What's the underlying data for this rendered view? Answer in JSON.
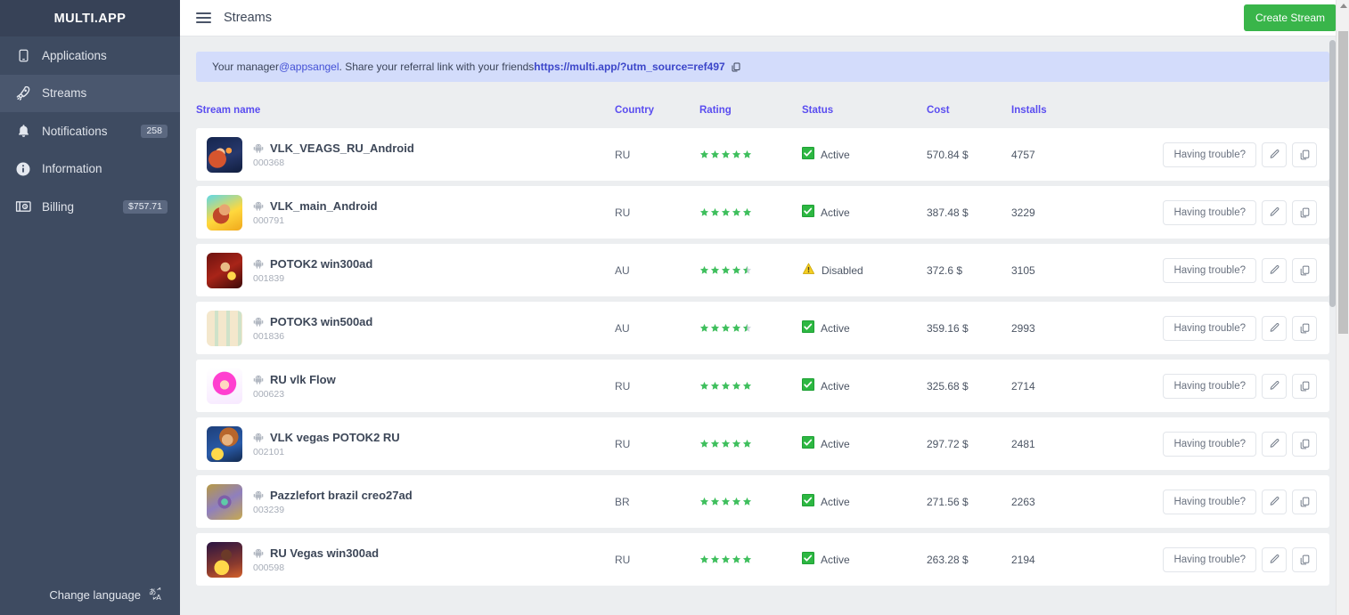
{
  "sidebar": {
    "brand": "MULTI.APP",
    "items": [
      {
        "label": "Applications",
        "icon": "phone-icon",
        "badge": "",
        "active": false
      },
      {
        "label": "Streams",
        "icon": "rocket-icon",
        "badge": "",
        "active": true
      },
      {
        "label": "Notifications",
        "icon": "bell-icon",
        "badge": "258",
        "active": false
      },
      {
        "label": "Information",
        "icon": "info-icon",
        "badge": "",
        "active": false
      },
      {
        "label": "Billing",
        "icon": "money-icon",
        "badge": "$757.71",
        "active": false
      }
    ],
    "footer": {
      "label": "Change language",
      "icon": "translate-icon"
    }
  },
  "header": {
    "menu_icon": "hamburger-icon",
    "title": "Streams",
    "create_button": "Create Stream"
  },
  "notice": {
    "prefix": "Your manager ",
    "handle": "@appsangel",
    "middle": ". Share your referral link with your friends ",
    "link": "https://multi.app/?utm_source=ref497",
    "copy_icon": "copy-icon"
  },
  "table": {
    "columns": [
      "Stream name",
      "Country",
      "Rating",
      "Status",
      "Cost",
      "Installs"
    ],
    "actions": {
      "trouble_label": "Having trouble?",
      "edit_icon": "pencil-icon",
      "copy_icon": "copy-icon"
    },
    "rows": [
      {
        "name": "VLK_VEAGS_RU_Android",
        "id": "000368",
        "country": "RU",
        "rating": 5,
        "status": "Active",
        "status_icon": "check-box-icon",
        "cost": "570.84 $",
        "installs": "4757",
        "thumb": "thumb-vlk-veags"
      },
      {
        "name": "VLK_main_Android",
        "id": "000791",
        "country": "RU",
        "rating": 5,
        "status": "Active",
        "status_icon": "check-box-icon",
        "cost": "387.48 $",
        "installs": "3229",
        "thumb": "thumb-vlk-main"
      },
      {
        "name": "POTOK2 win300ad",
        "id": "001839",
        "country": "AU",
        "rating": 4.5,
        "status": "Disabled",
        "status_icon": "warning-triangle-icon",
        "cost": "372.6 $",
        "installs": "3105",
        "thumb": "thumb-potok2"
      },
      {
        "name": "POTOK3 win500ad",
        "id": "001836",
        "country": "AU",
        "rating": 4.5,
        "status": "Active",
        "status_icon": "check-box-icon",
        "cost": "359.16 $",
        "installs": "2993",
        "thumb": "thumb-potok3"
      },
      {
        "name": "RU vlk Flow",
        "id": "000623",
        "country": "RU",
        "rating": 5,
        "status": "Active",
        "status_icon": "check-box-icon",
        "cost": "325.68 $",
        "installs": "2714",
        "thumb": "thumb-ruvlk"
      },
      {
        "name": "VLK vegas POTOK2 RU",
        "id": "002101",
        "country": "RU",
        "rating": 5,
        "status": "Active",
        "status_icon": "check-box-icon",
        "cost": "297.72 $",
        "installs": "2481",
        "thumb": "thumb-vlkvegas"
      },
      {
        "name": "Pazzlefort brazil creo27ad",
        "id": "003239",
        "country": "BR",
        "rating": 5,
        "status": "Active",
        "status_icon": "check-box-icon",
        "cost": "271.56 $",
        "installs": "2263",
        "thumb": "thumb-pazzlefort"
      },
      {
        "name": "RU Vegas win300ad",
        "id": "000598",
        "country": "RU",
        "rating": 5,
        "status": "Active",
        "status_icon": "check-box-icon",
        "cost": "263.28 $",
        "installs": "2194",
        "thumb": "thumb-ruvegas"
      }
    ]
  },
  "colors": {
    "sidebar_bg": "#3e4b61",
    "sidebar_active": "#4a576e",
    "accent_link": "#5a4df0",
    "create_green": "#39b54a",
    "star_green": "#3fbf5d",
    "status_active": "#2db742",
    "status_warning": "#f2c318",
    "notice_bg": "#d3dcfb",
    "page_bg": "#eceef0"
  }
}
